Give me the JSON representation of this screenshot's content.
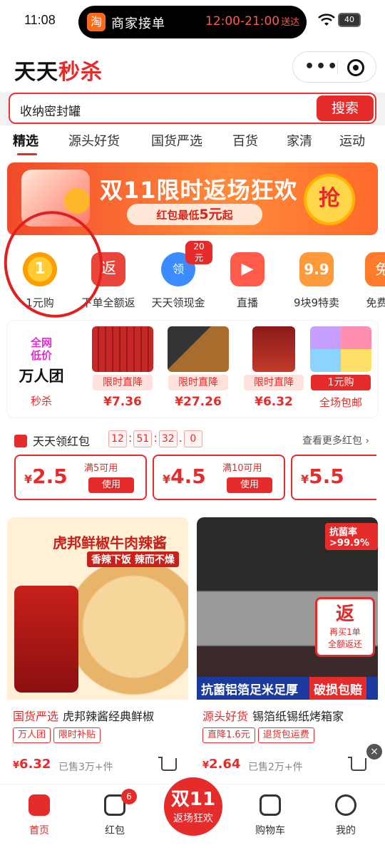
{
  "status": {
    "time": "11:08",
    "battery": "40",
    "live_icon": "淘",
    "live_text": "商家接单",
    "live_hours": "12:00-21:00",
    "live_suffix": "送达"
  },
  "header": {
    "logo_a": "天天",
    "logo_b": "秒杀",
    "dots": "•••"
  },
  "search": {
    "query": "收纳密封罐",
    "button": "搜索"
  },
  "tabs": [
    "精选",
    "源头好货",
    "国货严选",
    "百货",
    "家清",
    "运动"
  ],
  "banner": {
    "title": "双11限时返场狂欢",
    "sub_a": "红包最低",
    "sub_num": "5元",
    "sub_b": "起",
    "grab": "抢"
  },
  "icons": [
    {
      "label": "1元购",
      "glyph": "1"
    },
    {
      "label": "下单全额返",
      "glyph": "返"
    },
    {
      "label": "天天领现金",
      "glyph": "领",
      "badge": "20元"
    },
    {
      "label": "直播",
      "glyph": "▶"
    },
    {
      "label": "9块9特卖",
      "glyph": "9.9"
    },
    {
      "label": "免费领",
      "glyph": "免"
    }
  ],
  "flash": {
    "a1": "全网",
    "a2": "低价",
    "b": "万人团",
    "c": "秒杀",
    "items": [
      {
        "tag": "限时直降",
        "price": "¥7.36"
      },
      {
        "tag": "限时直降",
        "price": "¥27.26"
      },
      {
        "tag": "限时直降",
        "price": "¥6.32"
      },
      {
        "tag": "1元购",
        "price": "全场包邮"
      }
    ]
  },
  "redpack": {
    "title": "天天领红包",
    "timer": [
      "12",
      "51",
      "32",
      "0"
    ],
    "more": "查看更多红包 ›",
    "coupons": [
      {
        "amount": "2.5",
        "cond": "满5可用",
        "use": "使用"
      },
      {
        "amount": "4.5",
        "cond": "满10可用",
        "use": "使用"
      },
      {
        "amount": "5.5",
        "cond": "",
        "use": ""
      }
    ]
  },
  "cards": [
    {
      "over": "虎邦鲜椒牛肉辣酱",
      "over2": "香辣下饭 辣而不燥",
      "src": "国货严选",
      "title": "虎邦辣酱经典鲜椒",
      "l1": "万人团",
      "l2": "限时补贴",
      "price_sym": "¥",
      "price": "6.32",
      "sold": "已售3万+件"
    },
    {
      "over": "抗菌铝箔足米足厚",
      "over2": "破损包赔",
      "src": "源头好货",
      "title": "锡箔纸锡纸烤箱家",
      "l1": "直降1.6元",
      "l2": "退货包运费",
      "price_sym": "¥",
      "price": "2.64",
      "sold": "已售2万+件",
      "badge": "返",
      "badge2": "再买1单",
      "badge3": "全额返还",
      "rate": "抗菌率 >99.9%"
    }
  ],
  "tabbar": {
    "home": "首页",
    "hongbao": "红包",
    "hb_badge": "6",
    "center1": "双11",
    "center2": "返场狂欢",
    "cart": "购物车",
    "mine": "我的"
  }
}
